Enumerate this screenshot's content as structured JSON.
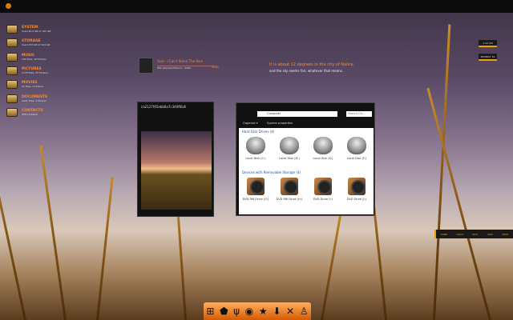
{
  "sidebar": {
    "items": [
      {
        "title": "SYSTEM",
        "sub": "Used 40.0 GB of 195 GB"
      },
      {
        "title": "STORAGE",
        "sub": "Used 232 GB of 244 GB"
      },
      {
        "title": "MUSIC",
        "sub": "166 Files, 16 Folders"
      },
      {
        "title": "PICTURES",
        "sub": "1778 Files, 33 Folders"
      },
      {
        "title": "MOVIES",
        "sub": "22 Files, 3 Folders"
      },
      {
        "title": "DOCUMENTS",
        "sub": "4421 Files, 3 Folders"
      },
      {
        "title": "CONTACTS",
        "sub": "438 Contacts"
      }
    ]
  },
  "media": {
    "track": "Seal - I Can't Stand The Rain",
    "album": "Hits (Deluxe Edition) • 2009",
    "time": "00:00"
  },
  "weather": {
    "line1": "It is about 12 degrees in the city of Nalice",
    "line2": "and the sky seems fair, whatever that means."
  },
  "clock": {
    "time": "1:12 AM",
    "date": "MONDAY 10"
  },
  "viewer": {
    "title": "ca2127f45ebb6a7c340f6b48..."
  },
  "explorer": {
    "address": "Computer",
    "search_placeholder": "Search Co...",
    "organize": "Organize ▾",
    "system_properties": "System properties",
    "groups": [
      {
        "label": "Hard Disk Drives (4)",
        "items": [
          "Local Disk (C:)",
          "Local Disk (D:)",
          "Local Disk (E:)",
          "Local Disk (F:)"
        ]
      },
      {
        "label": "Devices with Removable Storage (4)",
        "items": [
          "DVD RW Drive (G:)",
          "DVD RW Drive (H:)",
          "DVD Drive (I:)",
          "DVD Drive (J:)"
        ]
      }
    ]
  },
  "bottombar": [
    "ZUNE",
    "DOCS",
    "PICS",
    "VIDS",
    "TRSH"
  ],
  "dock": [
    "windows",
    "shield",
    "wheat",
    "media",
    "star",
    "download",
    "tools",
    "figure"
  ],
  "accent": "#ff8a2a"
}
